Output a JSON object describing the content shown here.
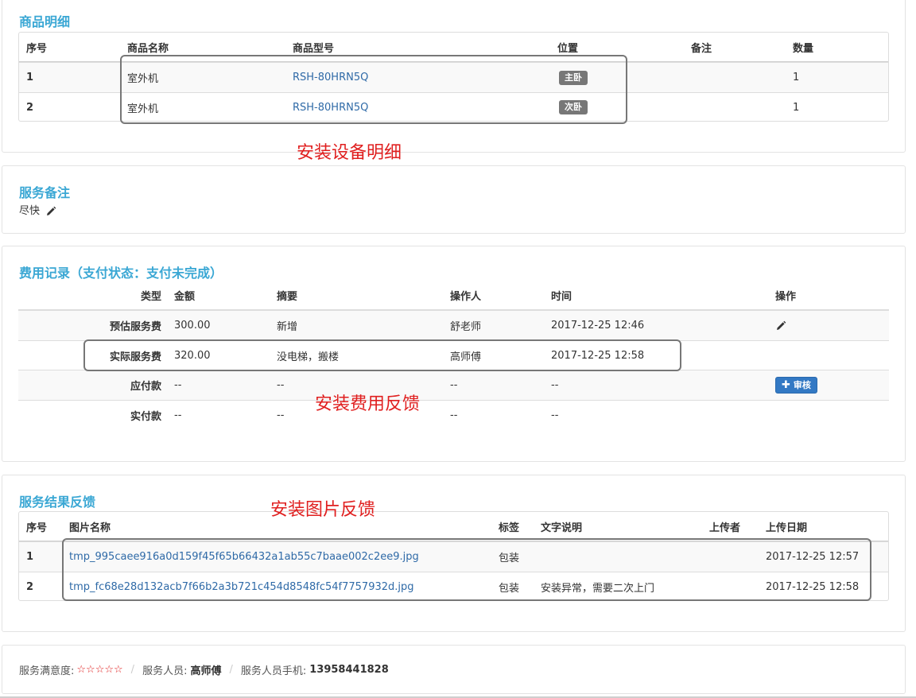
{
  "goods": {
    "title": "商品明细",
    "headers": [
      "序号",
      "商品名称",
      "商品型号",
      "位置",
      "备注",
      "数量"
    ],
    "rows": [
      {
        "no": "1",
        "name": "室外机",
        "model": "RSH-80HRN5Q",
        "position": "主卧",
        "remark": "",
        "qty": "1"
      },
      {
        "no": "2",
        "name": "室外机",
        "model": "RSH-80HRN5Q",
        "position": "次卧",
        "remark": "",
        "qty": "1"
      }
    ],
    "annotation": "安装设备明细"
  },
  "service_note": {
    "title": "服务备注",
    "text": "尽快"
  },
  "fees": {
    "title": "费用记录（支付状态：支付未完成）",
    "headers": [
      "类型",
      "金额",
      "摘要",
      "操作人",
      "时间",
      "操作"
    ],
    "rows": [
      {
        "type": "预估服务费",
        "amount": "300.00",
        "summary": "新增",
        "operator": "舒老师",
        "time": "2017-12-25 12:46",
        "action": "edit"
      },
      {
        "type": "实际服务费",
        "amount": "320.00",
        "summary": "没电梯，搬楼",
        "operator": "高师傅",
        "time": "2017-12-25 12:58",
        "action": ""
      },
      {
        "type": "应付款",
        "amount": "--",
        "summary": "--",
        "operator": "--",
        "time": "--",
        "action": "audit"
      },
      {
        "type": "实付款",
        "amount": "--",
        "summary": "--",
        "operator": "--",
        "time": "--",
        "action": ""
      }
    ],
    "audit_label": "审核",
    "annotation": "安装费用反馈"
  },
  "results": {
    "title": "服务结果反馈",
    "annotation": "安装图片反馈",
    "headers": [
      "序号",
      "图片名称",
      "标签",
      "文字说明",
      "上传者",
      "上传日期"
    ],
    "rows": [
      {
        "no": "1",
        "name": "tmp_995caee916a0d159f45f65b66432a1ab55c7baae002c2ee9.jpg",
        "tag": "包装",
        "desc": "",
        "uploader": "",
        "date": "2017-12-25 12:57"
      },
      {
        "no": "2",
        "name": "tmp_fc68e28d132acb7f66b2a3b721c454d8548fc54f7757932d.jpg",
        "tag": "包装",
        "desc": "安装异常，需要二次上门",
        "uploader": "",
        "date": "2017-12-25 12:58"
      }
    ]
  },
  "footer": {
    "satisfaction_label": "服务满意度:",
    "stars": "☆☆☆☆☆",
    "staff_label": "服务人员:",
    "staff_name": "高师傅",
    "phone_label": "服务人员手机:",
    "phone": "13958441828",
    "separator": "/"
  },
  "colors": {
    "title": "#3aa7d4",
    "annotation": "#e02020",
    "link": "#2f6aa7",
    "tag": "#777777",
    "button": "#3379c4"
  },
  "icons": {
    "edit": "pencil-icon",
    "audit": "plus-icon"
  }
}
